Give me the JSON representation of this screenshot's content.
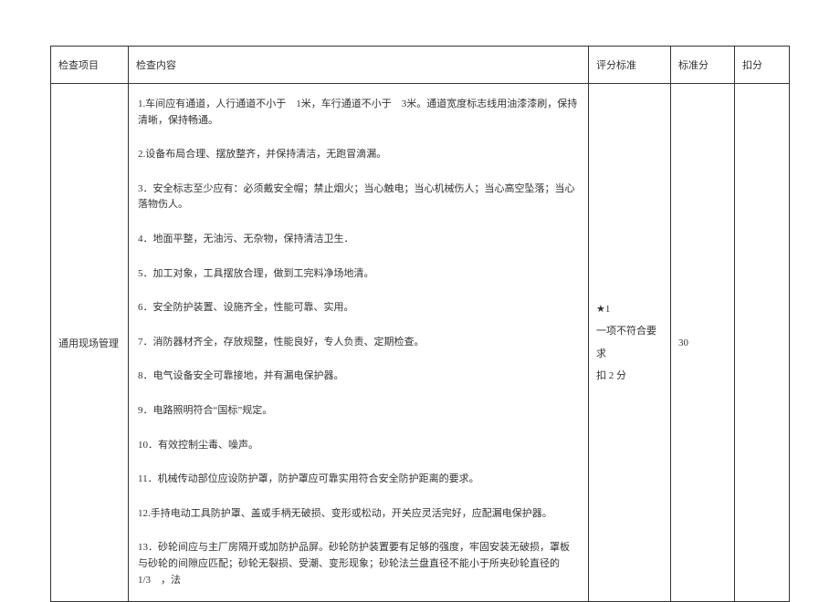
{
  "headers": {
    "project": "检查项目",
    "content": "检查内容",
    "criteria": "评分标准",
    "score": "标准分",
    "deduct": "扣分"
  },
  "row": {
    "project": "通用现场管理",
    "content_items": [
      "1.车间应有通道，人行通道不小于　1米，车行通道不小于　3米。通道宽度标志线用油漆漆刷，保持清晰，保持畅通。",
      "2.设备布局合理、摆放整齐，并保持清洁，无跑冒滴漏。",
      "3．安全标志至少应有：必须戴安全帽；禁止烟火；当心触电；当心机械伤人；当心高空坠落；当心落物伤人。",
      "4．地面平整，无油污、无杂物，保持清洁卫生．",
      "5．加工对象，工具摆放合理，做到工完料净场地清。",
      "6．安全防护装置、设施齐全，性能可靠、实用。",
      "7．消防器材齐全，存放规整，性能良好，专人负责、定期检查。",
      "8．电气设备安全可靠接地，并有漏电保护器。",
      "9．电路照明符合“国标”规定。",
      "10．有效控制尘毒、噪声。",
      "11．机械传动部位应设防护罩，防护罩应可靠实用符合安全防护距离的要求。",
      "12.手持电动工具防护罩、盖或手柄无破损、变形或松动，开关应灵活完好，应配漏电保护器。",
      "13．砂轮间应与主厂房隔开或加防护品屏。砂轮防护装置要有足够的强度，牢固安装无破损，罩板与砂轮的间隙应匹配；砂轮无裂损、受潮、变形现象；砂轮法兰盘直径不能小于所夹砂轮直径的　　　　1/3　，法"
    ],
    "criteria_lines": [
      "★1",
      "一项不符合要求",
      "扣 2 分"
    ],
    "score": "30",
    "deduct": ""
  }
}
